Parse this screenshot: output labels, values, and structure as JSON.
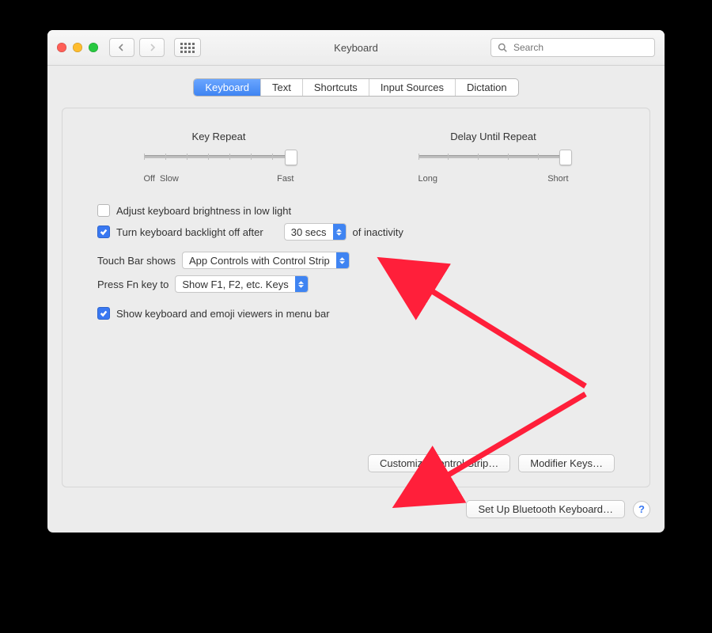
{
  "window": {
    "title": "Keyboard"
  },
  "search": {
    "placeholder": "Search"
  },
  "tabs": [
    {
      "label": "Keyboard",
      "active": true
    },
    {
      "label": "Text"
    },
    {
      "label": "Shortcuts"
    },
    {
      "label": "Input Sources"
    },
    {
      "label": "Dictation"
    }
  ],
  "sliders": {
    "keyRepeat": {
      "caption": "Key Repeat",
      "labels": [
        "Off",
        "Slow",
        "Fast"
      ]
    },
    "delay": {
      "caption": "Delay Until Repeat",
      "labels": [
        "Long",
        "Short"
      ]
    }
  },
  "checkboxes": {
    "adjustBrightness": {
      "label": "Adjust keyboard brightness in low light",
      "checked": false
    },
    "backlightOff": {
      "label": "Turn keyboard backlight off after",
      "suffix": "of inactivity",
      "value": "30 secs",
      "checked": true
    },
    "showViewers": {
      "label": "Show keyboard and emoji viewers in menu bar",
      "checked": true
    }
  },
  "dropdowns": {
    "touchBar": {
      "label": "Touch Bar shows",
      "value": "App Controls with Control Strip"
    },
    "fnKey": {
      "label": "Press Fn key to",
      "value": "Show F1, F2, etc. Keys"
    }
  },
  "buttons": {
    "customize": "Customize Control Strip…",
    "modifier": "Modifier Keys…",
    "bluetooth": "Set Up Bluetooth Keyboard…"
  },
  "annotation": {
    "color": "#ff1f3a"
  }
}
